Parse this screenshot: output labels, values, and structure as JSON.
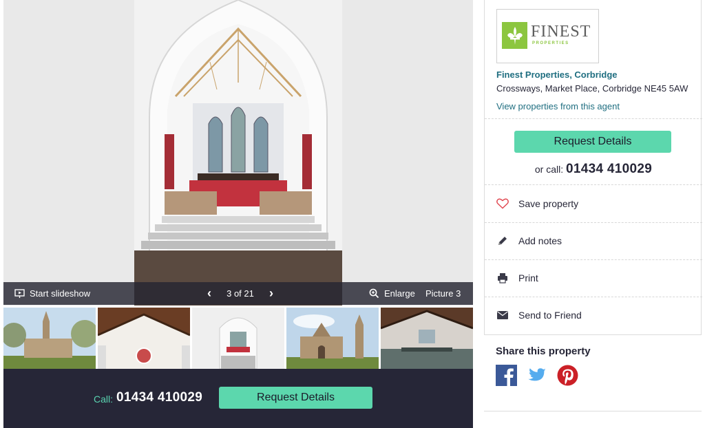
{
  "gallery": {
    "controls": {
      "slideshow_label": "Start slideshow",
      "counter": "3 of 21",
      "enlarge_label": "Enlarge",
      "picture_label": "Picture 3"
    },
    "call_label": "Call:",
    "call_number": "01434 410029",
    "request_button": "Request Details"
  },
  "agent": {
    "logo_word": "FINEST",
    "logo_sub": "PROPERTIES",
    "name": "Finest Properties, Corbridge",
    "address": "Crossways, Market Place, Corbridge NE45 5AW",
    "link": "View properties from this agent",
    "request_button": "Request Details",
    "call_prefix": "or call:",
    "call_number": "01434 410029"
  },
  "actions": [
    {
      "label": "Save property",
      "icon": "heart-icon"
    },
    {
      "label": "Add notes",
      "icon": "pencil-icon"
    },
    {
      "label": "Print",
      "icon": "printer-icon"
    },
    {
      "label": "Send to Friend",
      "icon": "envelope-icon"
    }
  ],
  "share": {
    "title": "Share this property",
    "networks": [
      "facebook-icon",
      "twitter-icon",
      "pinterest-icon"
    ]
  },
  "colors": {
    "accent_green": "#5cd7ad",
    "dark_navy": "#262637",
    "link_teal": "#1f6e80",
    "logo_green": "#8cc63f",
    "facebook": "#3b5998",
    "twitter": "#55acee",
    "pinterest": "#cb2027",
    "heart_red": "#e0464f"
  }
}
